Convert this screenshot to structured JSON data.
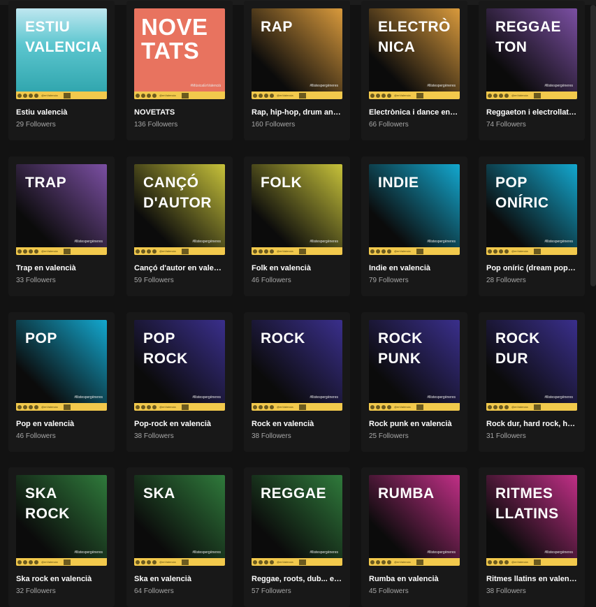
{
  "playlists": [
    {
      "cover": "ESTIU\nVALENCIA",
      "title": "Estiu valencià",
      "followers": "29 Followers",
      "theme": "beach",
      "hashtag": ""
    },
    {
      "cover": "NOVE\nTATS",
      "title": "NOVETATS",
      "followers": "136 Followers",
      "theme": "coral",
      "hashtag": "#MúsicaEnValencià"
    },
    {
      "cover": "RAP",
      "title": "Rap, hip-hop, drum and bass en valencià",
      "followers": "160 Followers",
      "theme": "orange",
      "hashtag": "#llistespergèneres"
    },
    {
      "cover": "ELECTRÒ\nNICA",
      "title": "Electrònica i dance en valencià",
      "followers": "66 Followers",
      "theme": "orange",
      "hashtag": "#llistespergèneres"
    },
    {
      "cover": "REGGAE\nTON",
      "title": "Reggaeton i electrollatí en valencià",
      "followers": "74 Followers",
      "theme": "violet",
      "hashtag": "#llistespergèneres"
    },
    {
      "cover": "TRAP",
      "title": "Trap en valencià",
      "followers": "33 Followers",
      "theme": "violet",
      "hashtag": "#llistespergèneres"
    },
    {
      "cover": "CANÇÓ\nD'AUTOR",
      "title": "Cançó d'autor en valencià",
      "followers": "59 Followers",
      "theme": "olive",
      "hashtag": "#llistespergèneres"
    },
    {
      "cover": "FOLK",
      "title": "Folk en valencià",
      "followers": "46 Followers",
      "theme": "olive",
      "hashtag": "#llistespergèneres"
    },
    {
      "cover": "INDIE",
      "title": "Indie en valencià",
      "followers": "79 Followers",
      "theme": "cyan",
      "hashtag": "#llistespergèneres"
    },
    {
      "cover": "POP\nONÍRIC",
      "title": "Pop oníric (dream pop) en valencià",
      "followers": "28 Followers",
      "theme": "cyan",
      "hashtag": "#llistespergèneres"
    },
    {
      "cover": "POP",
      "title": "Pop en valencià",
      "followers": "46 Followers",
      "theme": "cyan",
      "hashtag": "#llistespergèneres"
    },
    {
      "cover": "POP\nROCK",
      "title": "Pop-rock en valencià",
      "followers": "38 Followers",
      "theme": "indigo",
      "hashtag": "#llistespergèneres"
    },
    {
      "cover": "ROCK",
      "title": "Rock en valencià",
      "followers": "38 Followers",
      "theme": "indigo",
      "hashtag": "#llistespergèneres"
    },
    {
      "cover": "ROCK\nPUNK",
      "title": "Rock punk en valencià",
      "followers": "25 Followers",
      "theme": "indigo",
      "hashtag": "#llistespergèneres"
    },
    {
      "cover": "ROCK\nDUR",
      "title": "Rock dur, hard rock, heavy en valencià",
      "followers": "31 Followers",
      "theme": "indigo",
      "hashtag": "#llistespergèneres"
    },
    {
      "cover": "SKA\nROCK",
      "title": "Ska rock en valencià",
      "followers": "32 Followers",
      "theme": "green",
      "hashtag": "#llistespergèneres"
    },
    {
      "cover": "SKA",
      "title": "Ska en valencià",
      "followers": "64 Followers",
      "theme": "green",
      "hashtag": "#llistespergèneres"
    },
    {
      "cover": "REGGAE",
      "title": "Reggae, roots, dub... en valencià",
      "followers": "57 Followers",
      "theme": "green",
      "hashtag": "#llistespergèneres"
    },
    {
      "cover": "RUMBA",
      "title": "Rumba en valencià",
      "followers": "45 Followers",
      "theme": "magenta",
      "hashtag": "#llistespergèneres"
    },
    {
      "cover": "RITMES\nLLATINS",
      "title": "Ritmes llatins en valencià",
      "followers": "38 Followers",
      "theme": "magenta",
      "hashtag": "#llistespergèneres"
    }
  ],
  "cover_handle": "@enValencia",
  "themes": {
    "beach": "#3fb3b8",
    "coral": "#e8735f",
    "orange": "#d99a3c",
    "violet": "#7b4fa3",
    "olive": "#c7c23a",
    "cyan": "#13a8cf",
    "indigo": "#3a2f8c",
    "green": "#2f7a3b",
    "magenta": "#c02f86"
  }
}
